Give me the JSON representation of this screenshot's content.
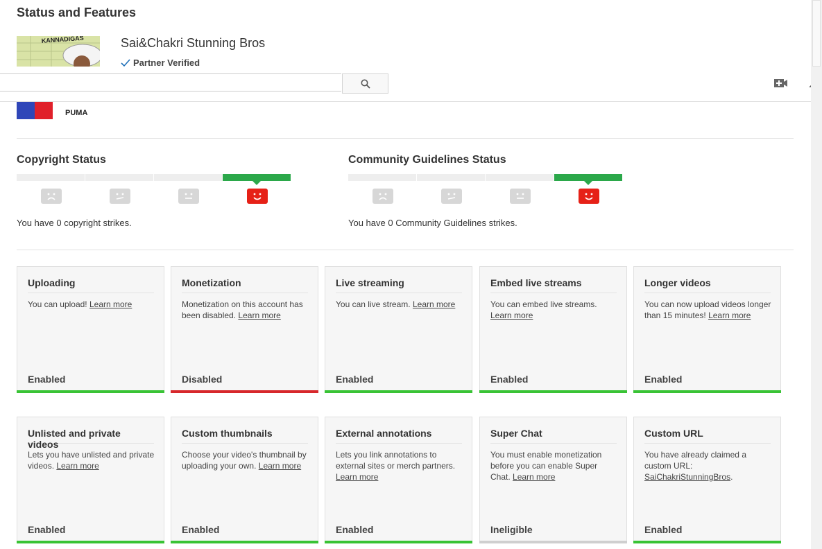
{
  "page": {
    "title": "Status and Features"
  },
  "channel": {
    "name": "Sai&Chakri Stunning Bros",
    "verified_label": "Partner Verified",
    "thumbnail_texts": [
      "KANNADIGAS",
      "PUMA"
    ]
  },
  "masthead": {
    "search_value": "",
    "search_placeholder": ""
  },
  "copyright": {
    "title": "Copyright Status",
    "text": "You have 0 copyright strikes."
  },
  "community": {
    "title": "Community Guidelines Status",
    "text": "You have 0 Community Guidelines strikes."
  },
  "colors": {
    "enabled": "#39c335",
    "disabled": "#d7282c",
    "ineligible": "#cfcfcf",
    "good_standing": "#2ba84a",
    "active_face": "#e62117"
  },
  "features": {
    "uploading": {
      "title": "Uploading",
      "desc": "You can upload!",
      "link": "Learn more",
      "status": "Enabled"
    },
    "monetization": {
      "title": "Monetization",
      "desc": "Monetization on this account has been disabled.",
      "link": "Learn more",
      "status": "Disabled"
    },
    "live_streaming": {
      "title": "Live streaming",
      "desc": "You can live stream.",
      "link": "Learn more",
      "status": "Enabled"
    },
    "embed_live": {
      "title": "Embed live streams",
      "desc": "You can embed live streams.",
      "link": "Learn more",
      "status": "Enabled"
    },
    "longer_videos": {
      "title": "Longer videos",
      "desc": "You can now upload videos longer than 15 minutes!",
      "link": "Learn more",
      "status": "Enabled"
    },
    "unlisted_private": {
      "title": "Unlisted and private videos",
      "desc": "Lets you have unlisted and private videos.",
      "link": "Learn more",
      "status": "Enabled"
    },
    "custom_thumbnails": {
      "title": "Custom thumbnails",
      "desc": "Choose your video's thumbnail by uploading your own.",
      "link": "Learn more",
      "status": "Enabled"
    },
    "external_annotations": {
      "title": "External annotations",
      "desc": "Lets you link annotations to external sites or merch partners.",
      "link": "Learn more",
      "status": "Enabled"
    },
    "super_chat": {
      "title": "Super Chat",
      "desc": "You must enable monetization before you can enable Super Chat.",
      "link": "Learn more",
      "status": "Ineligible"
    },
    "custom_url": {
      "title": "Custom URL",
      "desc": "You have already claimed a custom URL:",
      "link": "SaiChakriStunningBros",
      "link_suffix": ".",
      "status": "Enabled"
    }
  }
}
